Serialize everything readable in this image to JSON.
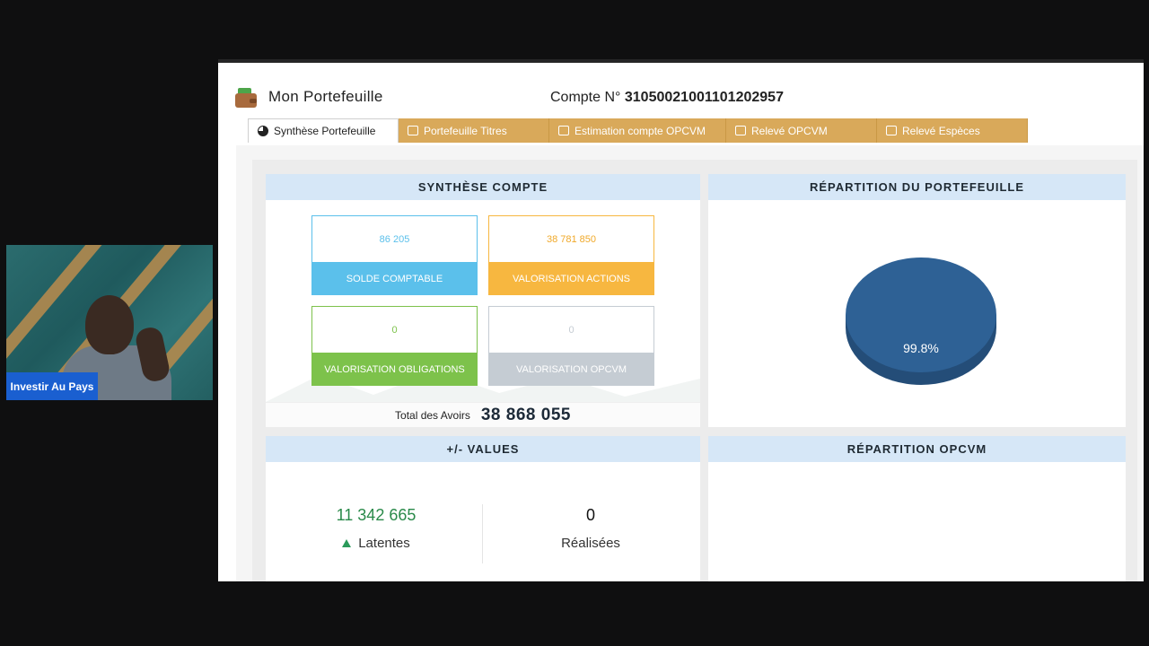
{
  "webcam": {
    "label": "Investir Au Pays"
  },
  "header": {
    "title": "Mon Portefeuille",
    "account_label": "Compte N°",
    "account_number": "31050021001101202957"
  },
  "tabs": [
    {
      "label": "Synthèse Portefeuille",
      "active": true
    },
    {
      "label": "Portefeuille Titres",
      "active": false
    },
    {
      "label": "Estimation compte OPCVM",
      "active": false
    },
    {
      "label": "Relevé OPCVM",
      "active": false
    },
    {
      "label": "Relevé Espèces",
      "active": false
    }
  ],
  "synthese": {
    "title": "SYNTHÈSE COMPTE",
    "cards": [
      {
        "value": "86 205",
        "label": "SOLDE COMPTABLE",
        "color": "#5bc0eb"
      },
      {
        "value": "38 781 850",
        "label": "VALORISATION ACTIONS",
        "color": "#f7b740"
      },
      {
        "value": "0",
        "label": "VALORISATION OBLIGATIONS",
        "color": "#7dc24b"
      },
      {
        "value": "0",
        "label": "VALORISATION OPCVM",
        "color": "#c5ccd3"
      }
    ],
    "total_label": "Total des Avoirs",
    "total_value": "38 868 055"
  },
  "repartition": {
    "title": "RÉPARTITION DU PORTEFEUILLE",
    "slice_label": "99.8%",
    "color": "#2e6195"
  },
  "values": {
    "title": "+/- VALUES",
    "latentes_value": "11 342 665",
    "latentes_label": "Latentes",
    "realisees_value": "0",
    "realisees_label": "Réalisées"
  },
  "opcvm": {
    "title": "RÉPARTITION OPCVM"
  }
}
